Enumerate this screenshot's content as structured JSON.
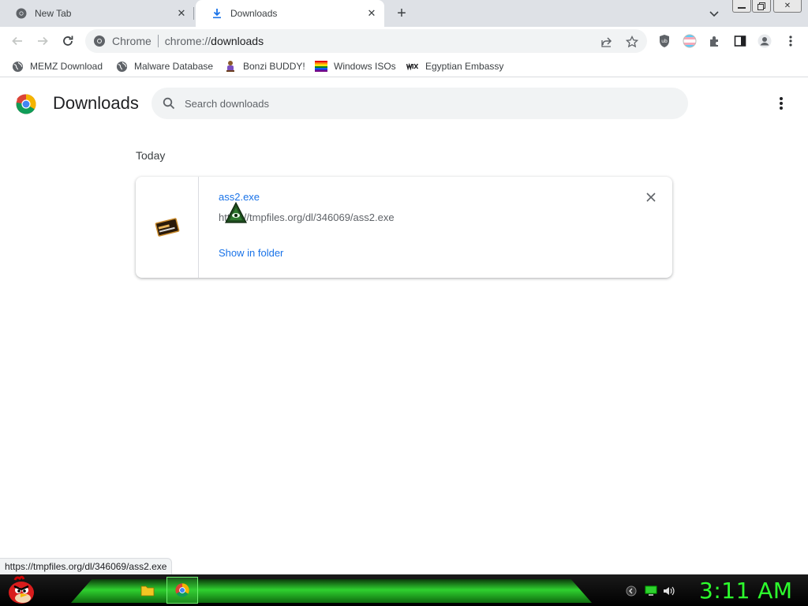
{
  "tabs": [
    {
      "title": "New Tab",
      "icon": "chrome-icon",
      "active": false
    },
    {
      "title": "Downloads",
      "icon": "download-icon",
      "active": true
    }
  ],
  "omnibox": {
    "site_label": "Chrome",
    "url_scheme": "chrome://",
    "url_host": "downloads"
  },
  "bookmarks": [
    {
      "label": "MEMZ Download",
      "icon": "globe-icon"
    },
    {
      "label": "Malware Database",
      "icon": "globe-icon"
    },
    {
      "label": "Bonzi BUDDY!",
      "icon": "bonzi-icon"
    },
    {
      "label": "Windows ISOs",
      "icon": "rainbow-flag-icon"
    },
    {
      "label": "Egyptian Embassy",
      "icon": "wix-icon"
    }
  ],
  "page": {
    "title": "Downloads",
    "search_placeholder": "Search downloads",
    "date_header": "Today"
  },
  "download": {
    "filename": "ass2.exe",
    "url": "https://tmpfiles.org/dl/346069/ass2.exe",
    "action": "Show in folder"
  },
  "status_url": "https://tmpfiles.org/dl/346069/ass2.exe",
  "taskbar": {
    "clock": "3:11 AM"
  },
  "colors": {
    "link_blue": "#1a73e8",
    "tab_strip": "#dee1e6",
    "clock_green": "#2dff2d"
  }
}
